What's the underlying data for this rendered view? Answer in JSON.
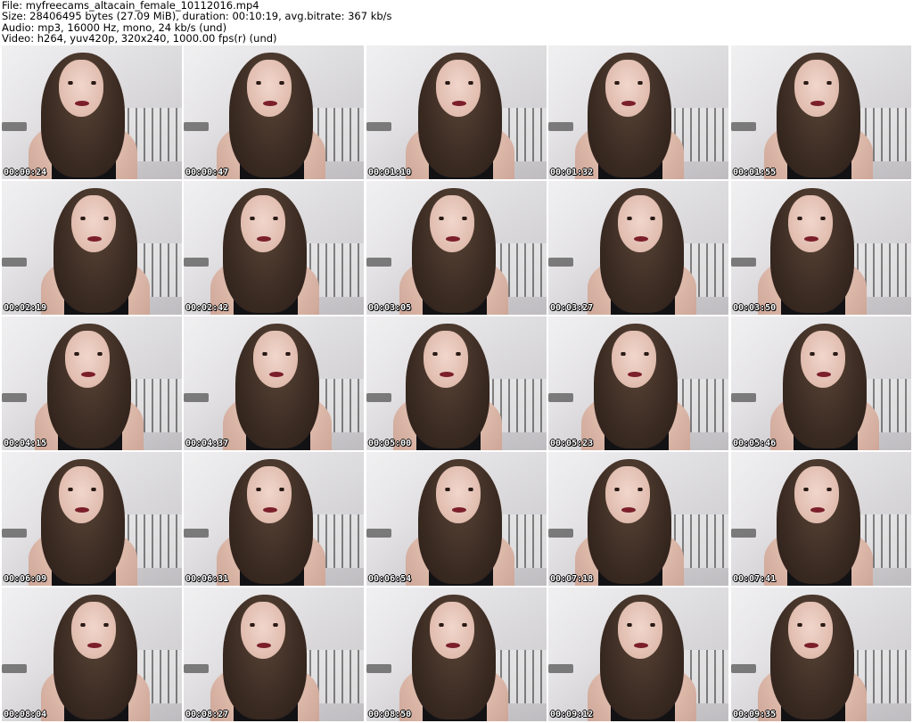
{
  "header": {
    "file_line": "File: myfreecams_altacain_female_10112016.mp4",
    "size_line": "Size: 28406495 bytes (27.09 MiB), duration: 00:10:19, avg.bitrate: 367 kb/s",
    "audio_line": "Audio: mp3, 16000 Hz, mono, 24 kb/s (und)",
    "video_line": "Video: h264, yuv420p, 320x240, 1000.00 fps(r) (und)"
  },
  "thumbnails": [
    {
      "timestamp": "00:00:24"
    },
    {
      "timestamp": "00:00:47"
    },
    {
      "timestamp": "00:01:10"
    },
    {
      "timestamp": "00:01:32"
    },
    {
      "timestamp": "00:01:55"
    },
    {
      "timestamp": "00:02:19"
    },
    {
      "timestamp": "00:02:42"
    },
    {
      "timestamp": "00:03:05"
    },
    {
      "timestamp": "00:03:27"
    },
    {
      "timestamp": "00:03:50"
    },
    {
      "timestamp": "00:04:15"
    },
    {
      "timestamp": "00:04:37"
    },
    {
      "timestamp": "00:05:00"
    },
    {
      "timestamp": "00:05:23"
    },
    {
      "timestamp": "00:05:46"
    },
    {
      "timestamp": "00:06:09"
    },
    {
      "timestamp": "00:06:31"
    },
    {
      "timestamp": "00:06:54"
    },
    {
      "timestamp": "00:07:18"
    },
    {
      "timestamp": "00:07:41"
    },
    {
      "timestamp": "00:08:04"
    },
    {
      "timestamp": "00:08:27"
    },
    {
      "timestamp": "00:08:50"
    },
    {
      "timestamp": "00:09:12"
    },
    {
      "timestamp": "00:09:35"
    }
  ]
}
